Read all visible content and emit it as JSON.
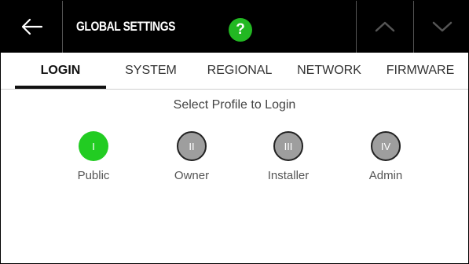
{
  "header": {
    "title": "GLOBAL SETTINGS",
    "help_symbol": "?",
    "back_icon": "arrow-left-icon",
    "up_icon": "chevron-up-icon",
    "down_icon": "chevron-down-icon"
  },
  "tabs": [
    {
      "label": "LOGIN",
      "active": true
    },
    {
      "label": "SYSTEM",
      "active": false
    },
    {
      "label": "REGIONAL",
      "active": false
    },
    {
      "label": "NETWORK",
      "active": false
    },
    {
      "label": "FIRMWARE",
      "active": false
    }
  ],
  "login": {
    "prompt": "Select Profile to Login",
    "profiles": [
      {
        "numeral": "I",
        "label": "Public",
        "selected": true
      },
      {
        "numeral": "II",
        "label": "Owner",
        "selected": false
      },
      {
        "numeral": "III",
        "label": "Installer",
        "selected": false
      },
      {
        "numeral": "IV",
        "label": "Admin",
        "selected": false
      }
    ]
  },
  "colors": {
    "header_bg": "#000000",
    "accent_green": "#22cc22",
    "help_green": "#22b822",
    "profile_gray": "#9e9e9e"
  }
}
